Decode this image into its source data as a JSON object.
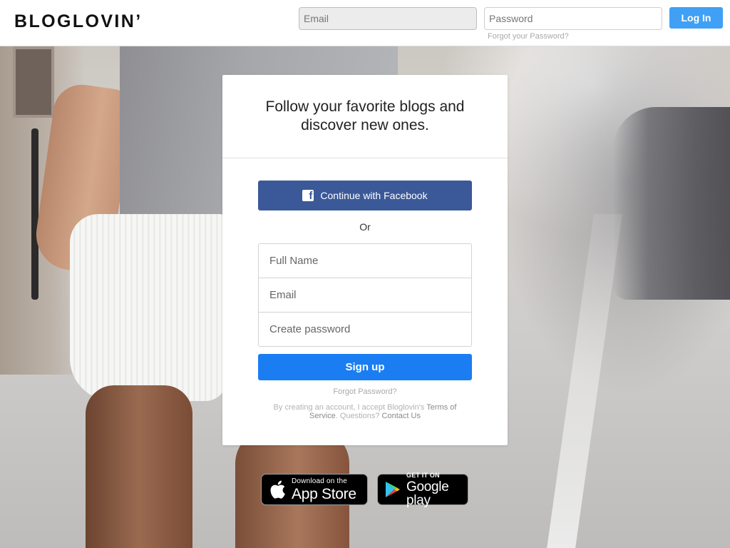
{
  "header": {
    "logo": "BLOGLOVIN’",
    "email_placeholder": "Email",
    "password_placeholder": "Password",
    "forgot_password": "Forgot your Password?",
    "login_label": "Log In"
  },
  "signup": {
    "title": "Follow your favorite blogs and discover new ones.",
    "facebook_label": "Continue with Facebook",
    "or_label": "Or",
    "fullname_placeholder": "Full Name",
    "email_placeholder": "Email",
    "password_placeholder": "Create password",
    "signup_label": "Sign up",
    "forgot_password": "Forgot Password?",
    "terms_prefix": "By creating an account, I accept Bloglovin's",
    "terms_link": "Terms of Service",
    "questions": ". Questions?",
    "contact_link": "Contact Us"
  },
  "badges": {
    "apple_small": "Download on the",
    "apple_big": "App Store",
    "google_small": "GET IT ON",
    "google_big": "Google play"
  },
  "colors": {
    "login_button": "#3fa0f5",
    "facebook_button": "#3b5998",
    "signup_button": "#1a7ef2"
  },
  "icons": {
    "facebook": "facebook-icon",
    "apple": "apple-icon",
    "google_play": "google-play-icon"
  }
}
